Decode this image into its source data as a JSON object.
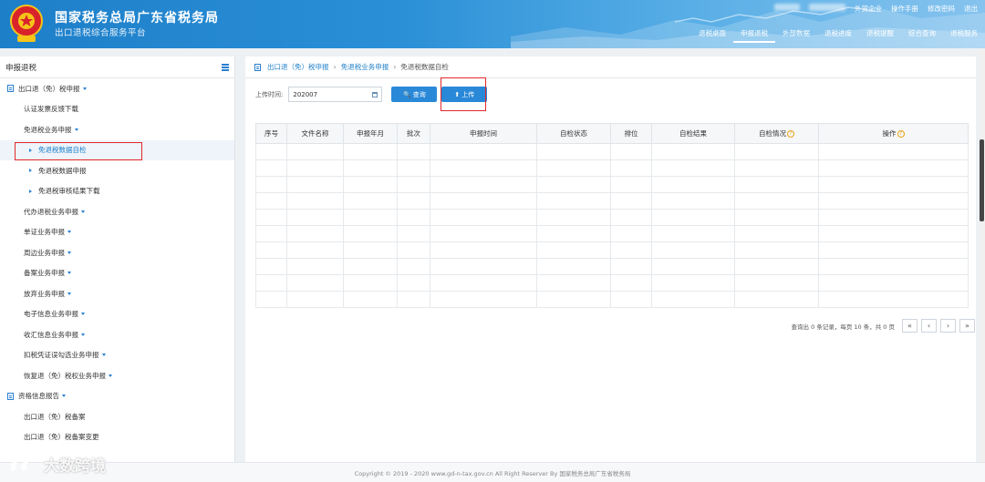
{
  "header": {
    "title": "国家税务总局广东省税务局",
    "subtitle": "出口退税综合服务平台",
    "top_links": [
      "外贸企业",
      "操作手册",
      "修改密码",
      "退出"
    ],
    "nav": [
      "退税桌面",
      "申报退税",
      "外部数据",
      "退税进度",
      "退税提醒",
      "综合查询",
      "退税服务"
    ],
    "nav_active": "申报退税"
  },
  "sidebar": {
    "title": "申报退税",
    "items": [
      {
        "label": "出口退（免）税申报",
        "level": 0,
        "expanded": true
      },
      {
        "label": "认证发票反馈下载",
        "level": 1
      },
      {
        "label": "免退税业务申报",
        "level": 1,
        "expanded": true
      },
      {
        "label": "免退税数据自检",
        "level": 2,
        "selected": true
      },
      {
        "label": "免退税数据申报",
        "level": 2
      },
      {
        "label": "免退税审核结果下载",
        "level": 2
      },
      {
        "label": "代办退税业务申报",
        "level": 1,
        "expanded": true
      },
      {
        "label": "单证业务申报",
        "level": 1,
        "expanded": true
      },
      {
        "label": "周边业务申报",
        "level": 1,
        "expanded": true
      },
      {
        "label": "备案业务申报",
        "level": 1,
        "expanded": true
      },
      {
        "label": "放弃业务申报",
        "level": 1,
        "expanded": true
      },
      {
        "label": "电子信息业务申报",
        "level": 1,
        "expanded": true
      },
      {
        "label": "收汇信息业务申报",
        "level": 1,
        "expanded": true
      },
      {
        "label": "扣税凭证误勾选业务申报",
        "level": 1,
        "expanded": true
      },
      {
        "label": "恢复退（免）税权业务申报",
        "level": 1,
        "expanded": true
      },
      {
        "label": "资格信息报告",
        "level": 0,
        "expanded": true
      },
      {
        "label": "出口退（免）税备案",
        "level": 1
      },
      {
        "label": "出口退（免）税备案变更",
        "level": 1
      }
    ]
  },
  "breadcrumb": [
    "出口退（免）税申报",
    "免退税业务申报",
    "免退税数据自检"
  ],
  "search": {
    "label": "上传时间:",
    "value": "202007",
    "query_button": "查询",
    "upload_button": "上传"
  },
  "table": {
    "columns": [
      "序号",
      "文件名称",
      "申报年月",
      "批次",
      "申报时间",
      "自检状态",
      "排位",
      "自检结果",
      "自检情况",
      "操作"
    ],
    "empty_rows": 10
  },
  "pager": {
    "info": "查询出 0 条记录，每页 10 条，共 0 页",
    "buttons": [
      "«",
      "‹",
      "›",
      "»"
    ]
  },
  "footer": "Copyright © 2019 - 2020 www.gd-n-tax.gov.cn All Right Reserver By 国家税务总局广东省税务局",
  "watermark": "大数跨境",
  "colors": {
    "primary": "#2a88d8",
    "highlight_box": "#e2272b",
    "header_start": "#1e7fc9"
  }
}
